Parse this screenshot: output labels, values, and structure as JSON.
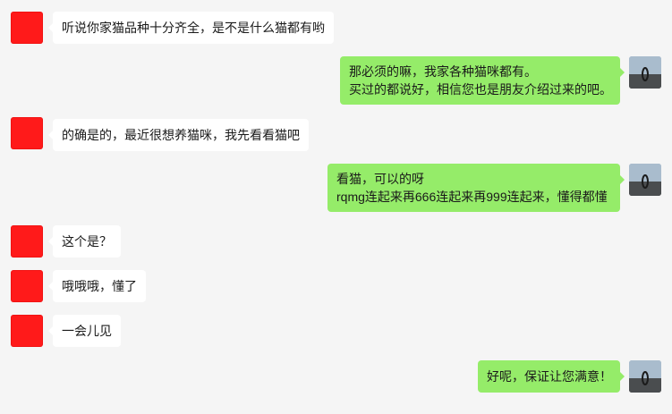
{
  "messages": [
    {
      "side": "left",
      "lines": [
        "听说你家猫品种十分齐全，是不是什么猫都有哟"
      ]
    },
    {
      "side": "right",
      "lines": [
        "那必须的嘛，我家各种猫咪都有。",
        "买过的都说好，相信您也是朋友介绍过来的吧。"
      ]
    },
    {
      "side": "left",
      "lines": [
        "的确是的，最近很想养猫咪，我先看看猫吧"
      ]
    },
    {
      "side": "right",
      "lines": [
        "看猫，可以的呀",
        "rqmg连起来再666连起来再999连起来，懂得都懂"
      ]
    },
    {
      "side": "left",
      "lines": [
        "这个是？"
      ]
    },
    {
      "side": "left",
      "lines": [
        "哦哦哦，懂了"
      ]
    },
    {
      "side": "left",
      "lines": [
        "一会儿见"
      ]
    },
    {
      "side": "right",
      "lines": [
        "好呢，保证让您满意！"
      ]
    }
  ],
  "colors": {
    "background": "#f5f5f5",
    "incoming_bubble": "#ffffff",
    "outgoing_bubble": "#95ec69",
    "contact_avatar": "#ff1a1a"
  },
  "icons": {
    "contact_avatar": "red-square-avatar",
    "self_avatar": "beach-sculpture-photo-avatar"
  }
}
